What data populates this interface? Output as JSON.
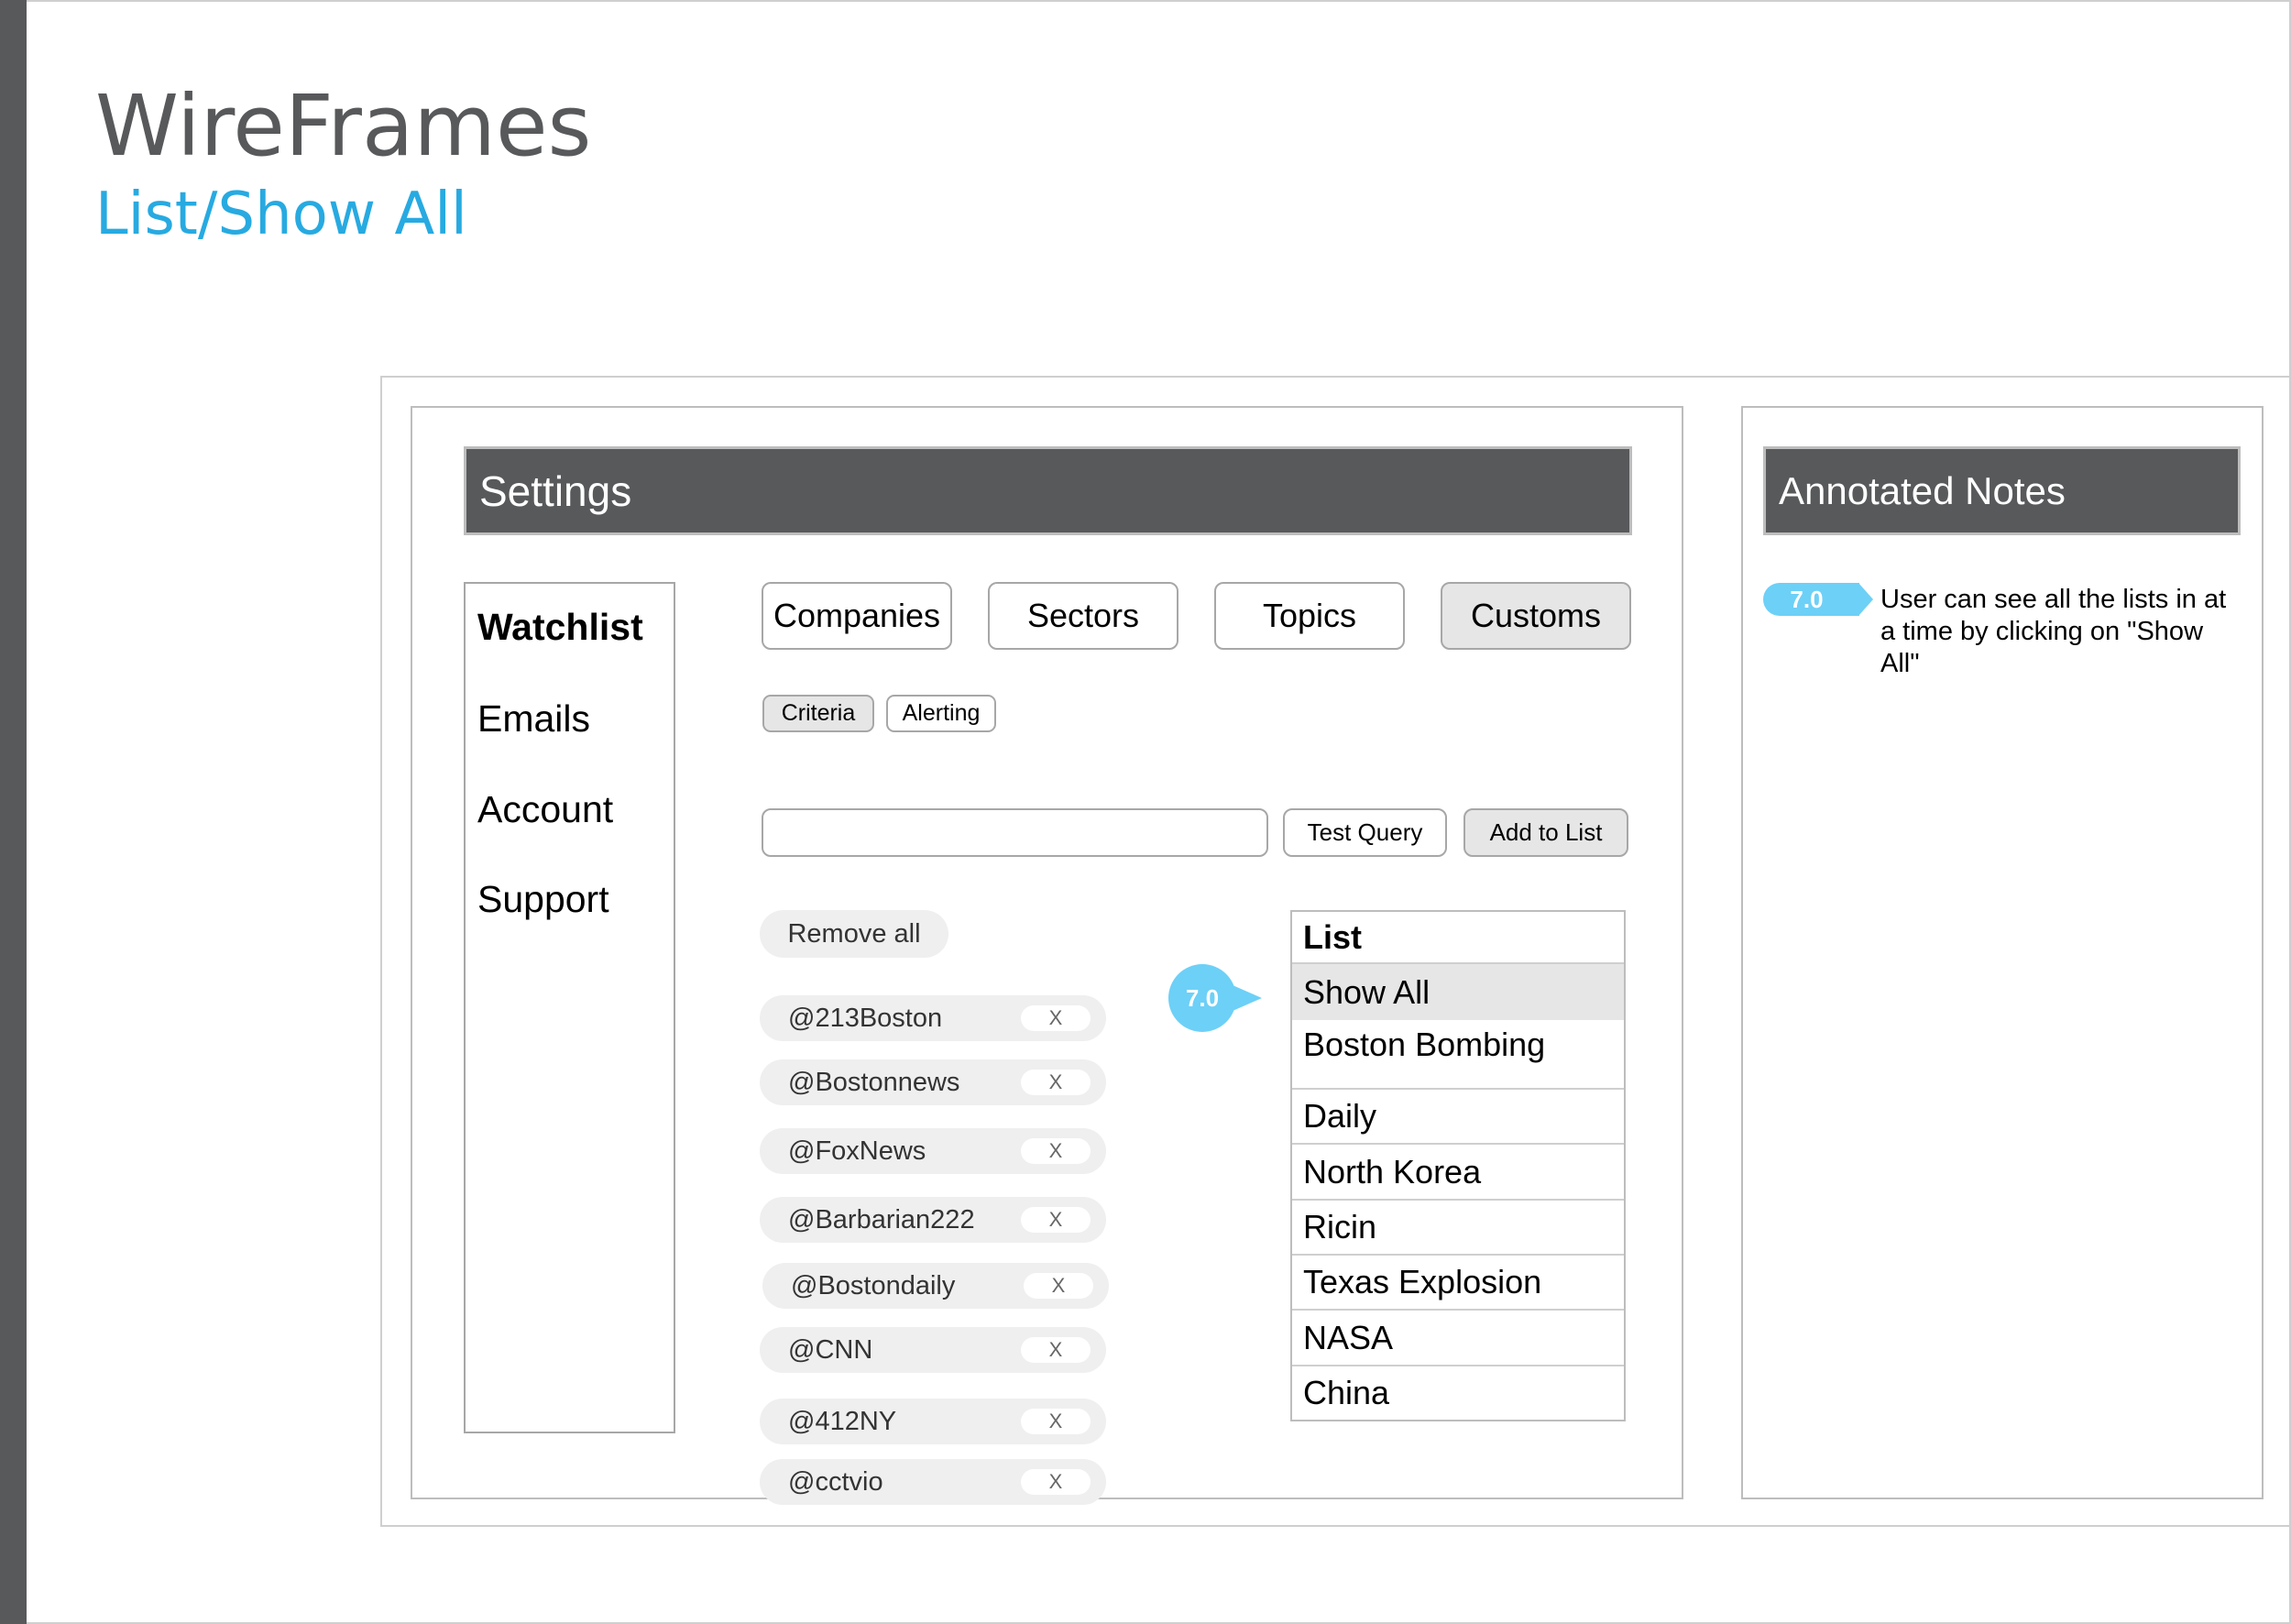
{
  "document": {
    "title": "WireFrames",
    "subtitle": "List/Show All"
  },
  "settings": {
    "header": "Settings",
    "sidebar": [
      {
        "label": "Watchlist",
        "active": true
      },
      {
        "label": "Emails",
        "active": false
      },
      {
        "label": "Account",
        "active": false
      },
      {
        "label": "Support",
        "active": false
      }
    ],
    "category_tabs": [
      {
        "label": "Companies",
        "active": false
      },
      {
        "label": "Sectors",
        "active": false
      },
      {
        "label": "Topics",
        "active": false
      },
      {
        "label": "Customs",
        "active": true
      }
    ],
    "sub_tabs": [
      {
        "label": "Criteria",
        "active": true
      },
      {
        "label": "Alerting",
        "active": false
      }
    ],
    "query": {
      "value": "",
      "placeholder": "",
      "test_label": "Test Query",
      "add_label": "Add to List"
    },
    "remove_all_label": "Remove all",
    "chip_remove_label": "X",
    "handles": [
      "@213Boston",
      "@Bostonnews",
      "@FoxNews",
      "@Barbarian222",
      "@Bostondaily",
      "@CNN",
      "@412NY",
      "@cctvio"
    ],
    "list": {
      "header": "List",
      "items": [
        "Show All",
        "Boston Bombing",
        "Daily",
        "North Korea",
        "Ricin",
        "Texas Explosion",
        "NASA",
        "China"
      ],
      "selected": "Show All"
    },
    "annotation_marker": "7.0"
  },
  "notes": {
    "header": "Annotated Notes",
    "items": [
      {
        "tag": "7.0",
        "text": "User can see all the lists in at a time by clicking on \"Show All\""
      }
    ]
  },
  "colors": {
    "header_bg": "#58595b",
    "accent": "#27aae1",
    "annotation": "#6dd0f7",
    "active_bg": "#e6e6e6",
    "chip_bg": "#efefef"
  }
}
